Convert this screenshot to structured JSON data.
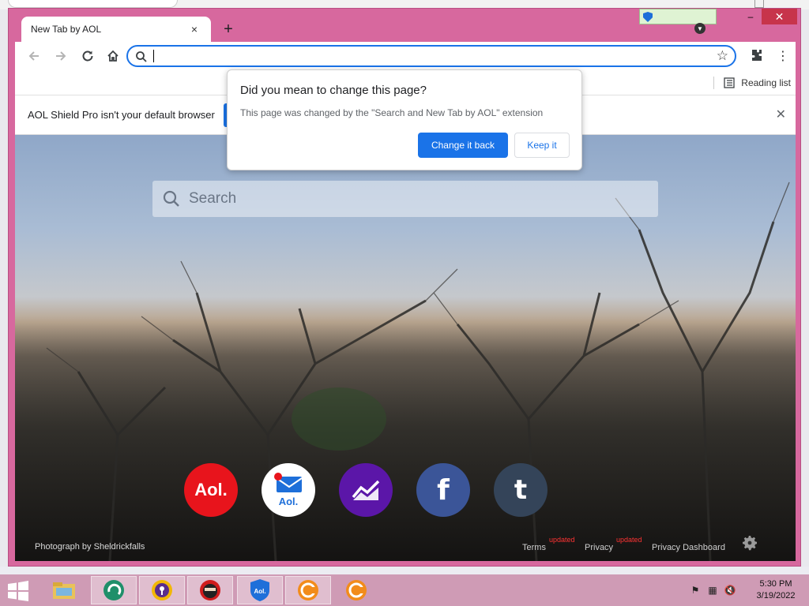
{
  "browser": {
    "tab_title": "New Tab by AOL",
    "tab_close": "×",
    "new_tab": "+",
    "omnibox_value": "",
    "reading_list": "Reading list"
  },
  "window_controls": {
    "minimize": "–",
    "maximize": "□",
    "close": "✕"
  },
  "infobar": {
    "message": "AOL Shield Pro isn't your default browser",
    "close": "✕"
  },
  "popup": {
    "title": "Did you mean to change this page?",
    "body": "This page was changed by the \"Search and New Tab by AOL\" extension",
    "primary_button": "Change it back",
    "secondary_button": "Keep it"
  },
  "newtab": {
    "search_placeholder": "Search",
    "photo_credit": "Photograph by Sheldrickfalls",
    "shortcuts": [
      {
        "name": "aol",
        "label": "Aol."
      },
      {
        "name": "aol-mail",
        "label": "Aol."
      },
      {
        "name": "finance",
        "label": ""
      },
      {
        "name": "facebook",
        "label": "f"
      },
      {
        "name": "tumblr",
        "label": "t"
      }
    ],
    "footer": {
      "terms": "Terms",
      "terms_badge": "updated",
      "privacy": "Privacy",
      "privacy_badge": "updated",
      "privacy_dashboard": "Privacy Dashboard"
    }
  },
  "taskbar": {
    "time": "5:30 PM",
    "date": "3/19/2022"
  },
  "colors": {
    "window_frame": "#d7689e",
    "accent": "#1a73e8",
    "aol_red": "#e8141c",
    "taskbar": "#cf9bb5"
  },
  "icons": [
    "back-icon",
    "forward-icon",
    "reload-icon",
    "home-icon",
    "search-icon",
    "star-icon",
    "extensions-icon",
    "menu-icon",
    "reading-list-icon",
    "gear-icon"
  ]
}
